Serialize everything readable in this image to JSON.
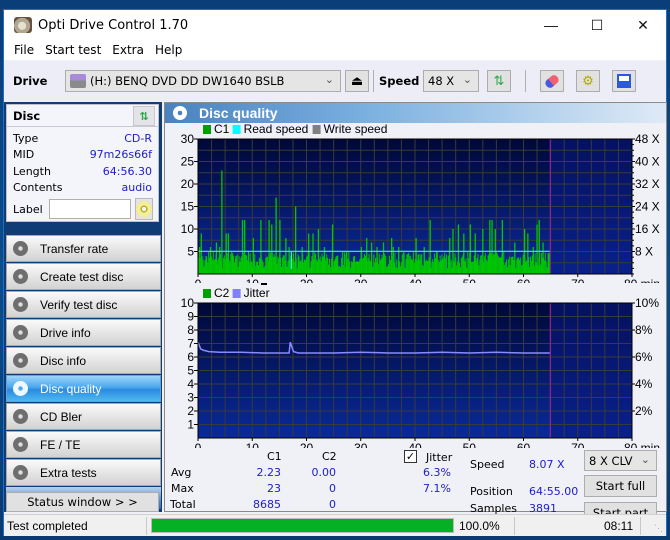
{
  "window": {
    "title": "Opti Drive Control 1.70",
    "controls": {
      "minimize": "—",
      "maximize": "☐",
      "close": "✕"
    }
  },
  "menu": [
    "File",
    "Start test",
    "Extra",
    "Help"
  ],
  "toolbar": {
    "drive_label": "Drive",
    "drive_value": "(H:)   BENQ DVD DD DW1640 BSLB",
    "speed_label": "Speed",
    "speed_value": "48 X",
    "icons": [
      "eject-icon",
      "refresh-icon",
      "erase-icon",
      "settings-icon",
      "save-icon"
    ]
  },
  "disc": {
    "header": "Disc",
    "fields": [
      {
        "key": "Type",
        "value": "CD-R"
      },
      {
        "key": "MID",
        "value": "97m26s66f"
      },
      {
        "key": "Length",
        "value": "64:56.30"
      },
      {
        "key": "Contents",
        "value": "audio"
      }
    ],
    "label_key": "Label",
    "label_value": ""
  },
  "nav": [
    {
      "label": "Transfer rate",
      "active": false
    },
    {
      "label": "Create test disc",
      "active": false
    },
    {
      "label": "Verify test disc",
      "active": false
    },
    {
      "label": "Drive info",
      "active": false
    },
    {
      "label": "Disc info",
      "active": false
    },
    {
      "label": "Disc quality",
      "active": true
    },
    {
      "label": "CD Bler",
      "active": false
    },
    {
      "label": "FE / TE",
      "active": false
    },
    {
      "label": "Extra tests",
      "active": false
    }
  ],
  "status_window_button": "Status window > >",
  "panel": {
    "title": "Disc quality"
  },
  "chart_data": [
    {
      "type": "bar",
      "title": "C1 / Read speed",
      "legend": [
        {
          "name": "C1",
          "color": "#00a000"
        },
        {
          "name": "Read speed",
          "color": "#00ffff"
        },
        {
          "name": "Write speed",
          "color": "#808080"
        }
      ],
      "x_ticks": [
        "0",
        "10",
        "20",
        "30",
        "40",
        "50",
        "60",
        "70",
        "80 min"
      ],
      "xlim": [
        0,
        80
      ],
      "y_left_ticks": [
        "5",
        "10",
        "15",
        "20",
        "25",
        "30"
      ],
      "ylim": [
        0,
        30
      ],
      "y_right_ticks": [
        "8 X",
        "16 X",
        "24 X",
        "32 X",
        "40 X",
        "48 X"
      ],
      "y_right_lim": [
        0,
        48
      ],
      "disc_end_min": 64.93,
      "read_speed_x": 8.07,
      "series": [
        {
          "name": "C1 baseline",
          "approx_avg": 2.23,
          "max": 23
        },
        {
          "name": "C1 peaks",
          "points": [
            [
              0.3,
              6
            ],
            [
              0.6,
              9
            ],
            [
              1.5,
              4
            ],
            [
              2.3,
              6
            ],
            [
              3.4,
              7
            ],
            [
              4.0,
              6
            ],
            [
              4.4,
              23
            ],
            [
              5.2,
              9
            ],
            [
              5.6,
              9
            ],
            [
              6.3,
              4
            ],
            [
              7.0,
              4
            ],
            [
              8.2,
              12
            ],
            [
              8.6,
              12
            ],
            [
              9.3,
              5
            ],
            [
              10.2,
              8
            ],
            [
              11.6,
              12
            ],
            [
              13.1,
              12
            ],
            [
              13.6,
              11
            ],
            [
              14.4,
              17
            ],
            [
              15.1,
              12
            ],
            [
              16.2,
              8
            ],
            [
              16.8,
              6
            ],
            [
              18.0,
              15
            ],
            [
              19.2,
              6
            ],
            [
              20.4,
              9
            ],
            [
              21.2,
              9
            ],
            [
              22.2,
              10
            ],
            [
              23.3,
              6
            ],
            [
              24.8,
              11
            ],
            [
              25.6,
              4
            ],
            [
              27.4,
              5
            ],
            [
              28.8,
              4
            ],
            [
              30.1,
              6
            ],
            [
              31.1,
              8
            ],
            [
              32.0,
              7
            ],
            [
              33.0,
              6
            ],
            [
              34.2,
              7
            ],
            [
              35.7,
              8
            ],
            [
              36.0,
              6
            ],
            [
              37.0,
              6
            ],
            [
              39.1,
              4
            ],
            [
              40.2,
              8
            ],
            [
              41.7,
              6
            ],
            [
              42.8,
              12
            ],
            [
              44.0,
              5
            ],
            [
              46.4,
              8
            ],
            [
              47.0,
              10
            ],
            [
              48.0,
              11
            ],
            [
              49.0,
              9
            ],
            [
              50.2,
              11
            ],
            [
              51.1,
              9
            ],
            [
              52.5,
              10
            ],
            [
              53.8,
              12
            ],
            [
              54.2,
              12
            ],
            [
              54.8,
              10
            ],
            [
              56.1,
              12
            ],
            [
              58.4,
              7
            ],
            [
              60.2,
              10
            ],
            [
              60.8,
              9
            ],
            [
              61.8,
              6
            ],
            [
              62.5,
              11
            ],
            [
              62.9,
              12
            ],
            [
              63.6,
              7
            ]
          ]
        }
      ]
    },
    {
      "type": "line",
      "title": "C2 / Jitter",
      "legend": [
        {
          "name": "C2",
          "color": "#00a000"
        },
        {
          "name": "Jitter",
          "color": "#8080ff"
        }
      ],
      "x_ticks": [
        "0",
        "10",
        "20",
        "30",
        "40",
        "50",
        "60",
        "70",
        "80 min"
      ],
      "xlim": [
        0,
        80
      ],
      "y_left_ticks": [
        "1",
        "2",
        "3",
        "4",
        "5",
        "6",
        "7",
        "8",
        "9",
        "10"
      ],
      "ylim": [
        0,
        10
      ],
      "y_right_ticks": [
        "2%",
        "4%",
        "6%",
        "8%",
        "10%"
      ],
      "y_right_lim": [
        0,
        10
      ],
      "disc_end_min": 64.93,
      "series": [
        {
          "name": "Jitter",
          "points": [
            [
              0,
              7.1
            ],
            [
              0.5,
              6.6
            ],
            [
              1.0,
              6.5
            ],
            [
              2.0,
              6.4
            ],
            [
              4,
              6.35
            ],
            [
              8,
              6.35
            ],
            [
              12,
              6.3
            ],
            [
              16.8,
              6.3
            ],
            [
              17.0,
              7.1
            ],
            [
              17.6,
              6.4
            ],
            [
              18.5,
              6.3
            ],
            [
              25,
              6.3
            ],
            [
              30,
              6.35
            ],
            [
              35,
              6.3
            ],
            [
              40,
              6.3
            ],
            [
              45,
              6.35
            ],
            [
              50,
              6.3
            ],
            [
              55,
              6.35
            ],
            [
              60,
              6.3
            ],
            [
              64.9,
              6.3
            ]
          ]
        },
        {
          "name": "C2",
          "points": []
        }
      ]
    }
  ],
  "stats": {
    "col_c1": "C1",
    "col_c2": "C2",
    "jitter_label": "Jitter",
    "jitter_checked": true,
    "rows": [
      {
        "label": "Avg",
        "c1": "2.23",
        "c2": "0.00",
        "jitter": "6.3%"
      },
      {
        "label": "Max",
        "c1": "23",
        "c2": "0",
        "jitter": "7.1%"
      },
      {
        "label": "Total",
        "c1": "8685",
        "c2": "0",
        "jitter": ""
      }
    ],
    "speed_label": "Speed",
    "speed_value": "8.07 X",
    "position_label": "Position",
    "position_value": "64:55.00",
    "samples_label": "Samples",
    "samples_value": "3891",
    "speed_select": "8 X CLV",
    "start_full": "Start full",
    "start_part": "Start part"
  },
  "statusbar": {
    "text": "Test completed",
    "progress": 1.0,
    "progress_text": "100.0%",
    "elapsed": "08:11"
  }
}
